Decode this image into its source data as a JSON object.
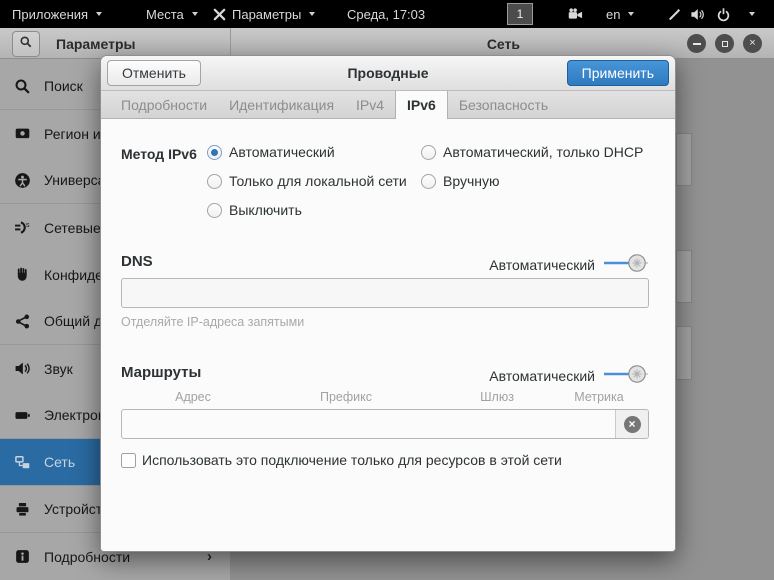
{
  "topbar": {
    "applications_label": "Приложения",
    "places_label": "Места",
    "settings_label": "Параметры",
    "clock": "Среда, 17:03",
    "workspace_indicator": "1",
    "keyboard_layout": "en"
  },
  "headerbar": {
    "sidebar_title": "Параметры",
    "page_title": "Сеть"
  },
  "sidebar": {
    "items": [
      {
        "label": "Поиск"
      },
      {
        "label": "Регион и"
      },
      {
        "label": "Универса"
      },
      {
        "label": "Сетевые"
      },
      {
        "label": "Конфиде"
      },
      {
        "label": "Общий д"
      },
      {
        "label": "Звук"
      },
      {
        "label": "Электроп"
      },
      {
        "label": "Сеть",
        "selected": true
      },
      {
        "label": "Устройст"
      },
      {
        "label": "Подробности",
        "chevron": "›"
      }
    ]
  },
  "dialog": {
    "title": "Проводные",
    "cancel_label": "Отменить",
    "apply_label": "Применить",
    "tabs": [
      {
        "label": "Подробности"
      },
      {
        "label": "Идентификация"
      },
      {
        "label": "IPv4"
      },
      {
        "label": "IPv6",
        "active": true
      },
      {
        "label": "Безопасность"
      }
    ],
    "method": {
      "label": "Метод IPv6",
      "selected": "Автоматический",
      "options_col1": [
        "Автоматический",
        "Только для локальной сети",
        "Выключить"
      ],
      "options_col2": [
        "Автоматический, только DHCP",
        "Вручную"
      ]
    },
    "dns": {
      "label": "DNS",
      "toggle_label": "Автоматический",
      "toggle_state": "on",
      "value": "",
      "hint": "Отделяйте IP-адреса запятыми"
    },
    "routes": {
      "label": "Маршруты",
      "toggle_label": "Автоматический",
      "toggle_state": "on",
      "columns": [
        "Адрес",
        "Префикс",
        "Шлюз",
        "Метрика"
      ],
      "value": ""
    },
    "checkbox_label": "Использовать это подключение только для ресурсов в этой сети",
    "checkbox_checked": false
  },
  "colors": {
    "accent_blue": "#4a90d9",
    "apply_button": "#3689d6",
    "selected_sidebar_row": "#2a6ba3",
    "topbar_bg": "#000000"
  }
}
